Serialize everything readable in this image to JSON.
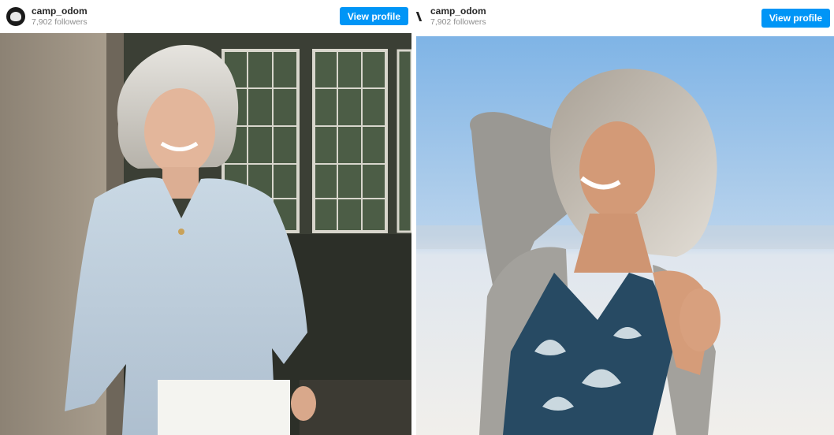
{
  "posts": [
    {
      "username": "camp_odom",
      "followers": "7,902 followers",
      "button_label": "View profile",
      "photo_icon": "woman-in-light-blue-blouse-photo",
      "accent": "#0095f6"
    },
    {
      "username": "camp_odom",
      "followers": "7,902 followers",
      "button_label": "View profile",
      "photo_icon": "woman-at-beach-photo",
      "accent": "#0095f6"
    }
  ]
}
